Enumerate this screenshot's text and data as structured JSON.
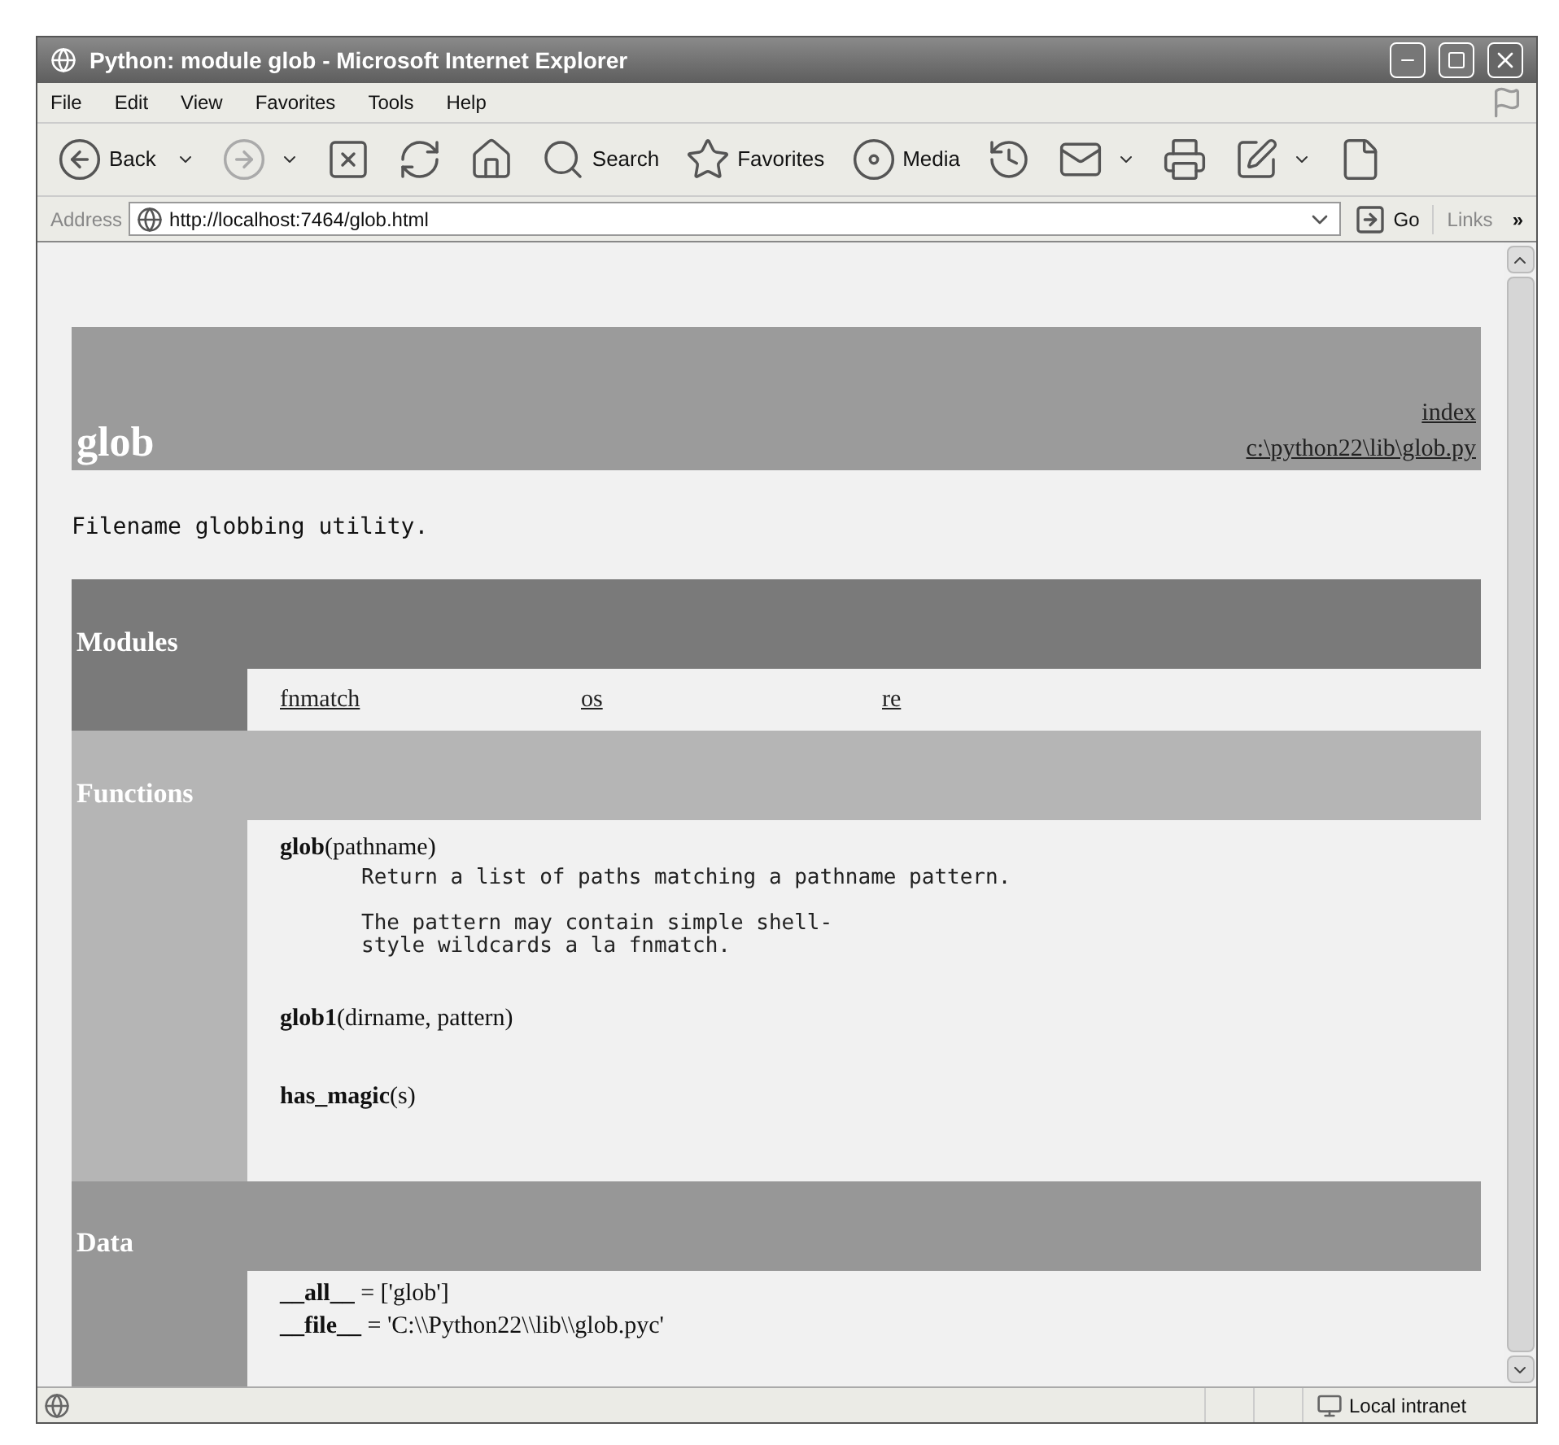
{
  "window": {
    "title": "Python: module glob - Microsoft Internet Explorer"
  },
  "menu": [
    "File",
    "Edit",
    "View",
    "Favorites",
    "Tools",
    "Help"
  ],
  "toolbar": [
    {
      "kind": "labeled",
      "label": "Back",
      "dropdown": true
    },
    {
      "kind": "icon",
      "dropdown": true,
      "disabled": true
    },
    {
      "kind": "icon",
      "dropdown": false,
      "disabled": false
    },
    {
      "kind": "icon",
      "dropdown": false,
      "disabled": false
    },
    {
      "kind": "icon",
      "dropdown": false,
      "disabled": false
    },
    {
      "kind": "labeled",
      "label": "Search",
      "dropdown": false
    },
    {
      "kind": "labeled",
      "label": "Favorites",
      "dropdown": false
    },
    {
      "kind": "labeled",
      "label": "Media",
      "dropdown": false
    },
    {
      "kind": "icon",
      "dropdown": false,
      "disabled": false
    },
    {
      "kind": "icon",
      "dropdown": true,
      "disabled": false
    },
    {
      "kind": "icon",
      "dropdown": false,
      "disabled": false
    },
    {
      "kind": "icon",
      "dropdown": true,
      "disabled": false
    },
    {
      "kind": "icon",
      "dropdown": false,
      "disabled": false
    }
  ],
  "address_bar": {
    "label": "Address",
    "value": "http://localhost:7464/glob.html",
    "go": "Go",
    "links": "Links",
    "more": "»"
  },
  "page": {
    "title": "glob",
    "links": [
      "index",
      "c:\\python22\\lib\\glob.py"
    ],
    "description": "Filename globbing utility.",
    "sections": [
      {
        "kind": "modules",
        "title": "Modules",
        "items": [
          "fnmatch",
          "os",
          "re"
        ]
      },
      {
        "kind": "functions",
        "title": "Functions",
        "items": [
          {
            "signature": "**glob**(pathname)",
            "doc": [
              [
                "Return a list of paths matching a pathname pattern."
              ],
              [
                "The pattern may contain simple shell-",
                "style wildcards a la fnmatch."
              ]
            ]
          },
          {
            "signature": "**glob1**(dirname, pattern)"
          },
          {
            "signature": "**has_magic**(s)"
          }
        ]
      },
      {
        "kind": "data",
        "title": "Data",
        "items": [
          "**__all__** = ['glob']",
          "**__file__** = 'C:\\\\Python22\\\\lib\\\\glob.pyc'"
        ]
      }
    ]
  },
  "status_bar": {
    "zone": "Local intranet"
  }
}
